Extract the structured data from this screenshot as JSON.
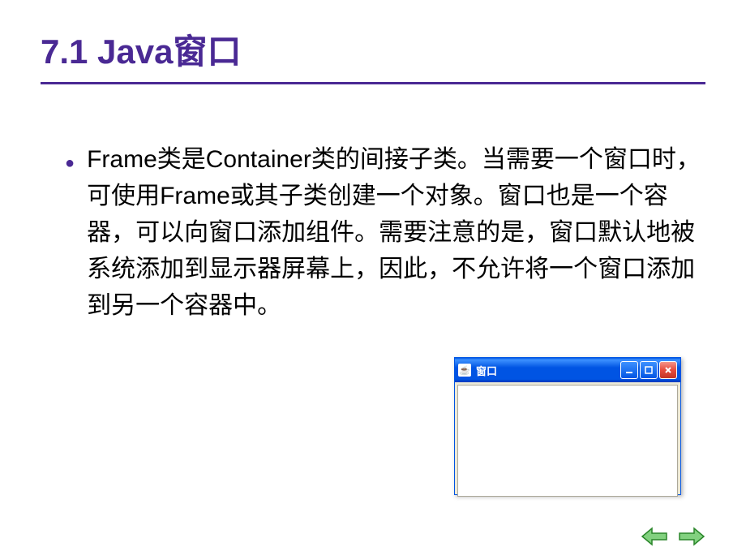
{
  "heading": "7.1 Java窗口",
  "content": {
    "bullet_text": "Frame类是Container类的间接子类。当需要一个窗口时，可使用Frame或其子类创建一个对象。窗口也是一个容器，可以向窗口添加组件。需要注意的是，窗口默认地被系统添加到显示器屏幕上，因此，不允许将一个窗口添加到另一个容器中。"
  },
  "window": {
    "title": "窗口",
    "icon_label": "☕"
  },
  "colors": {
    "heading": "#4a2994",
    "titlebar": "#0054e3",
    "close_btn": "#e74b3c",
    "nav_fill": "#82d17f",
    "nav_stroke": "#2a862a"
  }
}
